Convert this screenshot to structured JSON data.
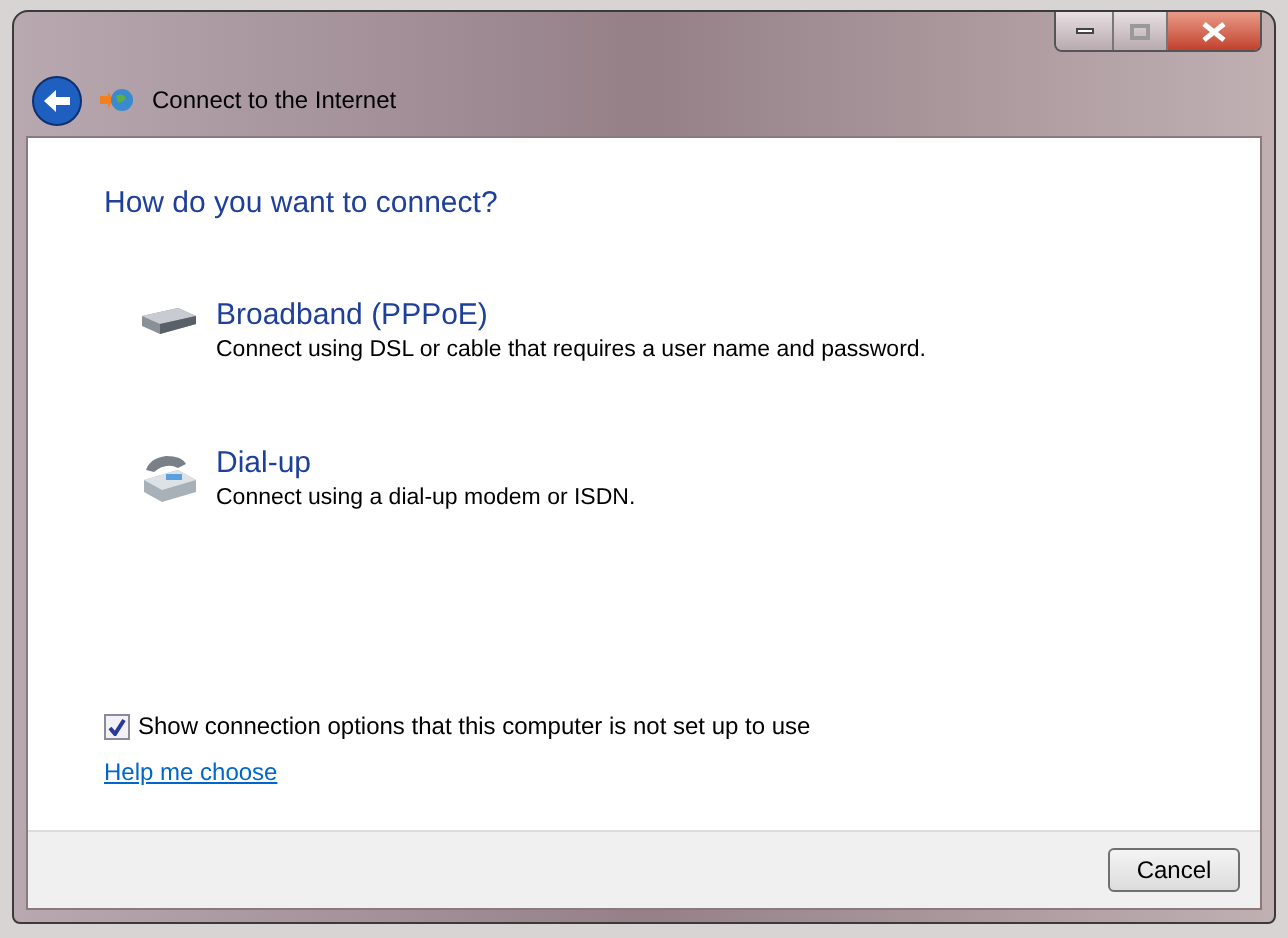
{
  "window": {
    "title": "Connect to the Internet"
  },
  "heading": "How do you want to connect?",
  "options": [
    {
      "kind": "broadband",
      "title": "Broadband (PPPoE)",
      "description": "Connect using DSL or cable that requires a user name and password."
    },
    {
      "kind": "dialup",
      "title": "Dial-up",
      "description": "Connect using a dial-up modem or ISDN."
    }
  ],
  "show_options": {
    "label": "Show connection options that this computer is not set up to use",
    "checked": true
  },
  "help_link": "Help me choose",
  "buttons": [
    "Cancel"
  ]
}
